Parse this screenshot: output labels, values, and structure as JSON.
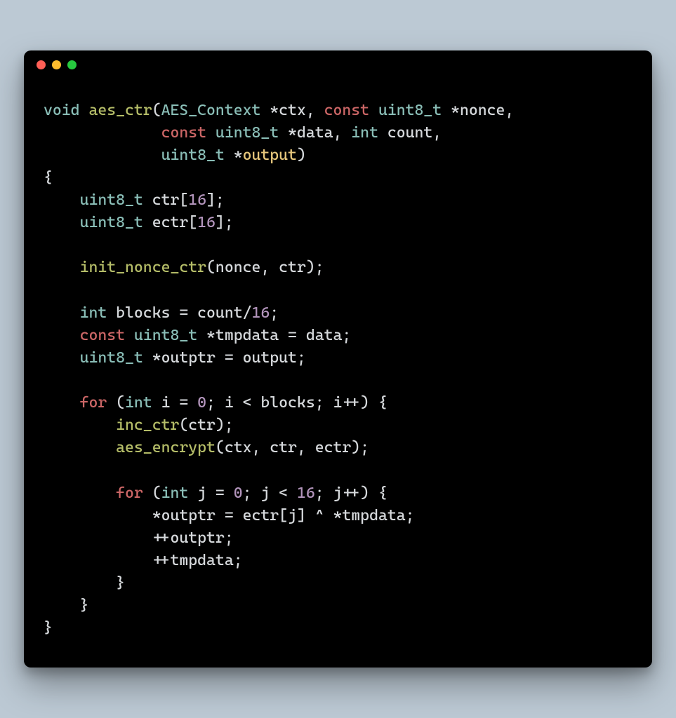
{
  "titlebar": {
    "buttons": [
      "close",
      "minimize",
      "zoom"
    ]
  },
  "code": {
    "tokens": [
      [
        [
          "type",
          "void"
        ],
        [
          "punct",
          " "
        ],
        [
          "fn",
          "aes_ctr"
        ],
        [
          "punct",
          "("
        ],
        [
          "type",
          "AES_Context"
        ],
        [
          "punct",
          " *"
        ],
        [
          "id",
          "ctx"
        ],
        [
          "punct",
          ", "
        ],
        [
          "kw",
          "const"
        ],
        [
          "punct",
          " "
        ],
        [
          "type",
          "uint8_t"
        ],
        [
          "punct",
          " *"
        ],
        [
          "id",
          "nonce"
        ],
        [
          "punct",
          ","
        ]
      ],
      [
        [
          "punct",
          "             "
        ],
        [
          "kw",
          "const"
        ],
        [
          "punct",
          " "
        ],
        [
          "type",
          "uint8_t"
        ],
        [
          "punct",
          " *"
        ],
        [
          "id",
          "data"
        ],
        [
          "punct",
          ", "
        ],
        [
          "type",
          "int"
        ],
        [
          "punct",
          " "
        ],
        [
          "id",
          "count"
        ],
        [
          "punct",
          ","
        ]
      ],
      [
        [
          "punct",
          "             "
        ],
        [
          "type",
          "uint8_t"
        ],
        [
          "punct",
          " *"
        ],
        [
          "param",
          "output"
        ],
        [
          "punct",
          ")"
        ]
      ],
      [
        [
          "punct",
          "{"
        ]
      ],
      [
        [
          "punct",
          "    "
        ],
        [
          "type",
          "uint8_t"
        ],
        [
          "punct",
          " "
        ],
        [
          "id",
          "ctr"
        ],
        [
          "punct",
          "["
        ],
        [
          "num",
          "16"
        ],
        [
          "punct",
          "];"
        ]
      ],
      [
        [
          "punct",
          "    "
        ],
        [
          "type",
          "uint8_t"
        ],
        [
          "punct",
          " "
        ],
        [
          "id",
          "ectr"
        ],
        [
          "punct",
          "["
        ],
        [
          "num",
          "16"
        ],
        [
          "punct",
          "];"
        ]
      ],
      [
        [
          "punct",
          ""
        ]
      ],
      [
        [
          "punct",
          "    "
        ],
        [
          "fn",
          "init_nonce_ctr"
        ],
        [
          "punct",
          "("
        ],
        [
          "id",
          "nonce"
        ],
        [
          "punct",
          ", "
        ],
        [
          "id",
          "ctr"
        ],
        [
          "punct",
          ");"
        ]
      ],
      [
        [
          "punct",
          ""
        ]
      ],
      [
        [
          "punct",
          "    "
        ],
        [
          "type",
          "int"
        ],
        [
          "punct",
          " "
        ],
        [
          "id",
          "blocks"
        ],
        [
          "punct",
          " = "
        ],
        [
          "id",
          "count"
        ],
        [
          "punct",
          "/"
        ],
        [
          "num",
          "16"
        ],
        [
          "punct",
          ";"
        ]
      ],
      [
        [
          "punct",
          "    "
        ],
        [
          "kw",
          "const"
        ],
        [
          "punct",
          " "
        ],
        [
          "type",
          "uint8_t"
        ],
        [
          "punct",
          " *"
        ],
        [
          "id",
          "tmpdata"
        ],
        [
          "punct",
          " = "
        ],
        [
          "id",
          "data"
        ],
        [
          "punct",
          ";"
        ]
      ],
      [
        [
          "punct",
          "    "
        ],
        [
          "type",
          "uint8_t"
        ],
        [
          "punct",
          " *"
        ],
        [
          "id",
          "outptr"
        ],
        [
          "punct",
          " = "
        ],
        [
          "id",
          "output"
        ],
        [
          "punct",
          ";"
        ]
      ],
      [
        [
          "punct",
          ""
        ]
      ],
      [
        [
          "punct",
          "    "
        ],
        [
          "kw",
          "for"
        ],
        [
          "punct",
          " ("
        ],
        [
          "type",
          "int"
        ],
        [
          "punct",
          " "
        ],
        [
          "id",
          "i"
        ],
        [
          "punct",
          " = "
        ],
        [
          "num",
          "0"
        ],
        [
          "punct",
          "; "
        ],
        [
          "id",
          "i"
        ],
        [
          "punct",
          " < "
        ],
        [
          "id",
          "blocks"
        ],
        [
          "punct",
          "; "
        ],
        [
          "id",
          "i"
        ],
        [
          "punct",
          "++) {"
        ]
      ],
      [
        [
          "punct",
          "        "
        ],
        [
          "fn",
          "inc_ctr"
        ],
        [
          "punct",
          "("
        ],
        [
          "id",
          "ctr"
        ],
        [
          "punct",
          ");"
        ]
      ],
      [
        [
          "punct",
          "        "
        ],
        [
          "fn",
          "aes_encrypt"
        ],
        [
          "punct",
          "("
        ],
        [
          "id",
          "ctx"
        ],
        [
          "punct",
          ", "
        ],
        [
          "id",
          "ctr"
        ],
        [
          "punct",
          ", "
        ],
        [
          "id",
          "ectr"
        ],
        [
          "punct",
          ");"
        ]
      ],
      [
        [
          "punct",
          ""
        ]
      ],
      [
        [
          "punct",
          "        "
        ],
        [
          "kw",
          "for"
        ],
        [
          "punct",
          " ("
        ],
        [
          "type",
          "int"
        ],
        [
          "punct",
          " "
        ],
        [
          "id",
          "j"
        ],
        [
          "punct",
          " = "
        ],
        [
          "num",
          "0"
        ],
        [
          "punct",
          "; "
        ],
        [
          "id",
          "j"
        ],
        [
          "punct",
          " < "
        ],
        [
          "num",
          "16"
        ],
        [
          "punct",
          "; "
        ],
        [
          "id",
          "j"
        ],
        [
          "punct",
          "++) {"
        ]
      ],
      [
        [
          "punct",
          "            *"
        ],
        [
          "id",
          "outptr"
        ],
        [
          "punct",
          " = "
        ],
        [
          "id",
          "ectr"
        ],
        [
          "punct",
          "["
        ],
        [
          "id",
          "j"
        ],
        [
          "punct",
          "] ^ *"
        ],
        [
          "id",
          "tmpdata"
        ],
        [
          "punct",
          ";"
        ]
      ],
      [
        [
          "punct",
          "            ++"
        ],
        [
          "id",
          "outptr"
        ],
        [
          "punct",
          ";"
        ]
      ],
      [
        [
          "punct",
          "            ++"
        ],
        [
          "id",
          "tmpdata"
        ],
        [
          "punct",
          ";"
        ]
      ],
      [
        [
          "punct",
          "        }"
        ]
      ],
      [
        [
          "punct",
          "    }"
        ]
      ],
      [
        [
          "punct",
          "}"
        ]
      ]
    ]
  }
}
